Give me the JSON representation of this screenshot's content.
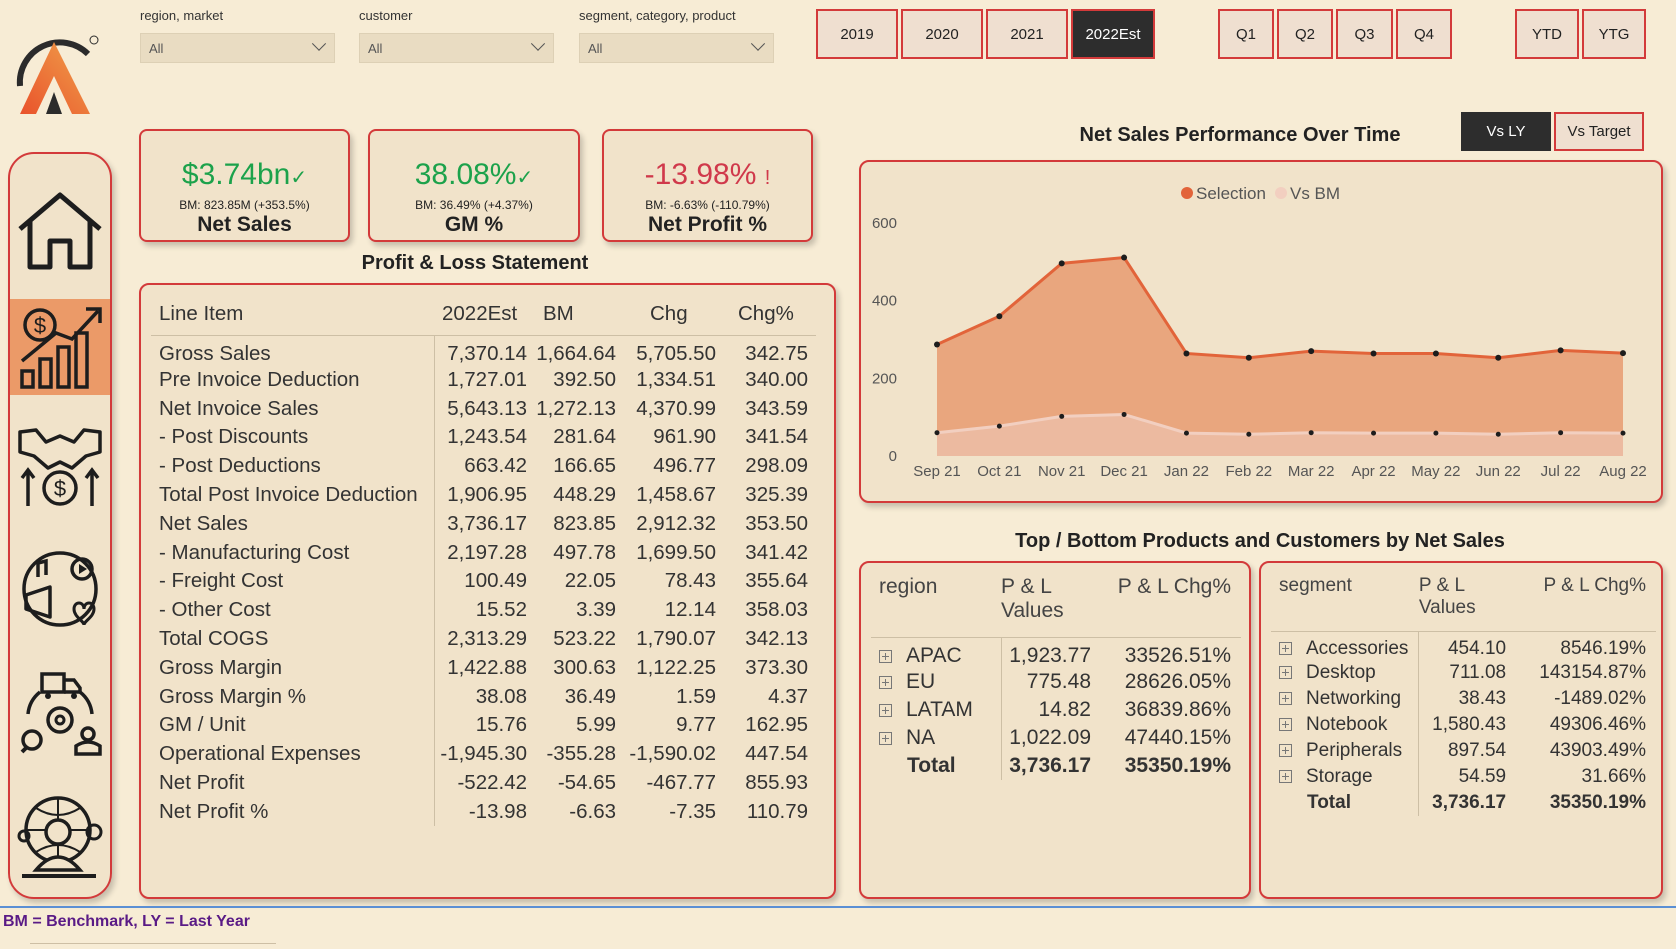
{
  "filters": [
    {
      "label": "region, market",
      "value": "All"
    },
    {
      "label": "customer",
      "value": "All"
    },
    {
      "label": "segment, category, product",
      "value": "All"
    }
  ],
  "years": [
    "2019",
    "2020",
    "2021",
    "2022Est"
  ],
  "selected_year": "2022Est",
  "quarters": [
    "Q1",
    "Q2",
    "Q3",
    "Q4"
  ],
  "periods": [
    "YTD",
    "YTG"
  ],
  "nav_icons": [
    "home-icon",
    "finance-growth-icon",
    "sales-handshake-icon",
    "marketing-icon",
    "supply-chain-icon",
    "executive-icon"
  ],
  "kpis": {
    "net_sales": {
      "value": "$3.74bn",
      "mark": "✓",
      "bm": "BM: 823.85M (+353.5%)",
      "title": "Net Sales"
    },
    "gm_pct": {
      "value": "38.08%",
      "mark": "✓",
      "bm": "BM: 36.49% (+4.37%)",
      "title": "GM %"
    },
    "net_profit_pct": {
      "value": "-13.98%",
      "mark": "!",
      "bm": "BM: -6.63% (-110.79%)",
      "title": "Net Profit %"
    }
  },
  "pl": {
    "title": "Profit & Loss Statement",
    "columns": [
      "Line Item",
      "2022Est",
      "BM",
      "Chg",
      "Chg%"
    ],
    "rows": [
      [
        "Gross Sales",
        "7,370.14",
        "1,664.64",
        "5,705.50",
        "342.75"
      ],
      [
        "Pre Invoice Deduction",
        "1,727.01",
        "392.50",
        "1,334.51",
        "340.00"
      ],
      [
        "Net Invoice Sales",
        "5,643.13",
        "1,272.13",
        "4,370.99",
        "343.59"
      ],
      [
        "- Post Discounts",
        "1,243.54",
        "281.64",
        "961.90",
        "341.54"
      ],
      [
        "- Post Deductions",
        "663.42",
        "166.65",
        "496.77",
        "298.09"
      ],
      [
        "Total Post Invoice Deduction",
        "1,906.95",
        "448.29",
        "1,458.67",
        "325.39"
      ],
      [
        "Net Sales",
        "3,736.17",
        "823.85",
        "2,912.32",
        "353.50"
      ],
      [
        "- Manufacturing Cost",
        "2,197.28",
        "497.78",
        "1,699.50",
        "341.42"
      ],
      [
        "- Freight Cost",
        "100.49",
        "22.05",
        "78.43",
        "355.64"
      ],
      [
        "- Other Cost",
        "15.52",
        "3.39",
        "12.14",
        "358.03"
      ],
      [
        "Total COGS",
        "2,313.29",
        "523.22",
        "1,790.07",
        "342.13"
      ],
      [
        "Gross Margin",
        "1,422.88",
        "300.63",
        "1,122.25",
        "373.30"
      ],
      [
        "Gross Margin %",
        "38.08",
        "36.49",
        "1.59",
        "4.37"
      ],
      [
        "GM / Unit",
        "15.76",
        "5.99",
        "9.77",
        "162.95"
      ],
      [
        "Operational Expenses",
        "-1,945.30",
        "-355.28",
        "-1,590.02",
        "447.54"
      ],
      [
        "Net Profit",
        "-522.42",
        "-54.65",
        "-467.77",
        "855.93"
      ],
      [
        "Net Profit %",
        "-13.98",
        "-6.63",
        "-7.35",
        "110.79"
      ]
    ]
  },
  "chart_toggle": [
    "Vs LY",
    "Vs Target"
  ],
  "chart_data": {
    "type": "area",
    "title": "Net Sales Performance Over Time",
    "categories": [
      "Sep 21",
      "Oct 21",
      "Nov 21",
      "Dec 21",
      "Jan 22",
      "Feb 22",
      "Mar 22",
      "Apr 22",
      "May 22",
      "Jun 22",
      "Jul 22",
      "Aug 22"
    ],
    "series": [
      {
        "name": "Selection",
        "color": "#e2643a",
        "values": [
          287,
          360,
          496,
          511,
          264,
          253,
          270,
          264,
          264,
          253,
          272,
          265
        ]
      },
      {
        "name": "Vs BM",
        "color": "#f2cfc0",
        "values": [
          60,
          77,
          102,
          107,
          59,
          56,
          60,
          59,
          59,
          56,
          60,
          59
        ]
      }
    ],
    "yticks": [
      0,
      200,
      400,
      600
    ],
    "ylim": [
      0,
      600
    ],
    "legend": "top-center",
    "grid": false
  },
  "top_bottom": {
    "title": "Top / Bottom Products and Customers by Net Sales",
    "region": {
      "columns": [
        "region",
        "P & L Values",
        "P & L Chg%"
      ],
      "rows": [
        [
          "APAC",
          "1,923.77",
          "33526.51%"
        ],
        [
          "EU",
          "775.48",
          "28626.05%"
        ],
        [
          "LATAM",
          "14.82",
          "36839.86%"
        ],
        [
          "NA",
          "1,022.09",
          "47440.15%"
        ]
      ],
      "total": [
        "Total",
        "3,736.17",
        "35350.19%"
      ]
    },
    "segment": {
      "columns": [
        "segment",
        "P & L Values",
        "P & L Chg%"
      ],
      "rows": [
        [
          "Accessories",
          "454.10",
          "8546.19%"
        ],
        [
          "Desktop",
          "711.08",
          "143154.87%"
        ],
        [
          "Networking",
          "38.43",
          "-1489.02%"
        ],
        [
          "Notebook",
          "1,580.43",
          "49306.46%"
        ],
        [
          "Peripherals",
          "897.54",
          "43903.49%"
        ],
        [
          "Storage",
          "54.59",
          "31.66%"
        ]
      ],
      "total": [
        "Total",
        "3,736.17",
        "35350.19%"
      ]
    }
  },
  "footer": "BM = Benchmark, LY = Last Year"
}
